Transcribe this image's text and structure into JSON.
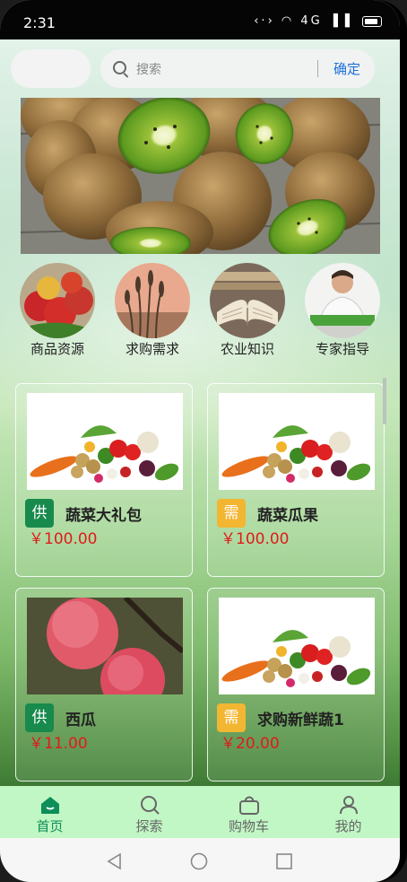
{
  "status_bar": {
    "time": "2:31",
    "network": "‹·› ◠ 4G ▐▐"
  },
  "search": {
    "placeholder": "搜索",
    "confirm_label": "确定"
  },
  "categories": [
    {
      "label": "商品资源",
      "icon": "apples-photo"
    },
    {
      "label": "求购需求",
      "icon": "wheat-photo"
    },
    {
      "label": "农业知识",
      "icon": "book-photo"
    },
    {
      "label": "专家指导",
      "icon": "expert-photo"
    }
  ],
  "products": [
    {
      "tag": "供",
      "tag_type": "supply",
      "title": "蔬菜大礼包",
      "price": "￥100.00",
      "image": "vegetables-photo"
    },
    {
      "tag": "需",
      "tag_type": "demand",
      "title": "蔬菜瓜果",
      "price": "￥100.00",
      "image": "vegetables-photo"
    },
    {
      "tag": "供",
      "tag_type": "supply",
      "title": "西瓜",
      "price": "￥11.00",
      "image": "apples-photo"
    },
    {
      "tag": "需",
      "tag_type": "demand",
      "title": "求购新鲜蔬1",
      "price": "￥20.00",
      "image": "vegetables-photo"
    }
  ],
  "tabs": [
    {
      "label": "首页",
      "icon": "home-icon",
      "active": true
    },
    {
      "label": "探索",
      "icon": "search-icon",
      "active": false
    },
    {
      "label": "购物车",
      "icon": "cart-icon",
      "active": false
    },
    {
      "label": "我的",
      "icon": "user-icon",
      "active": false
    }
  ],
  "colors": {
    "accent": "#0e8e58",
    "supply_tag": "#178a4c",
    "demand_tag": "#f2b632",
    "price": "#e01b1b",
    "tabbar": "#c1f7c4",
    "confirm": "#1e6fd9"
  }
}
